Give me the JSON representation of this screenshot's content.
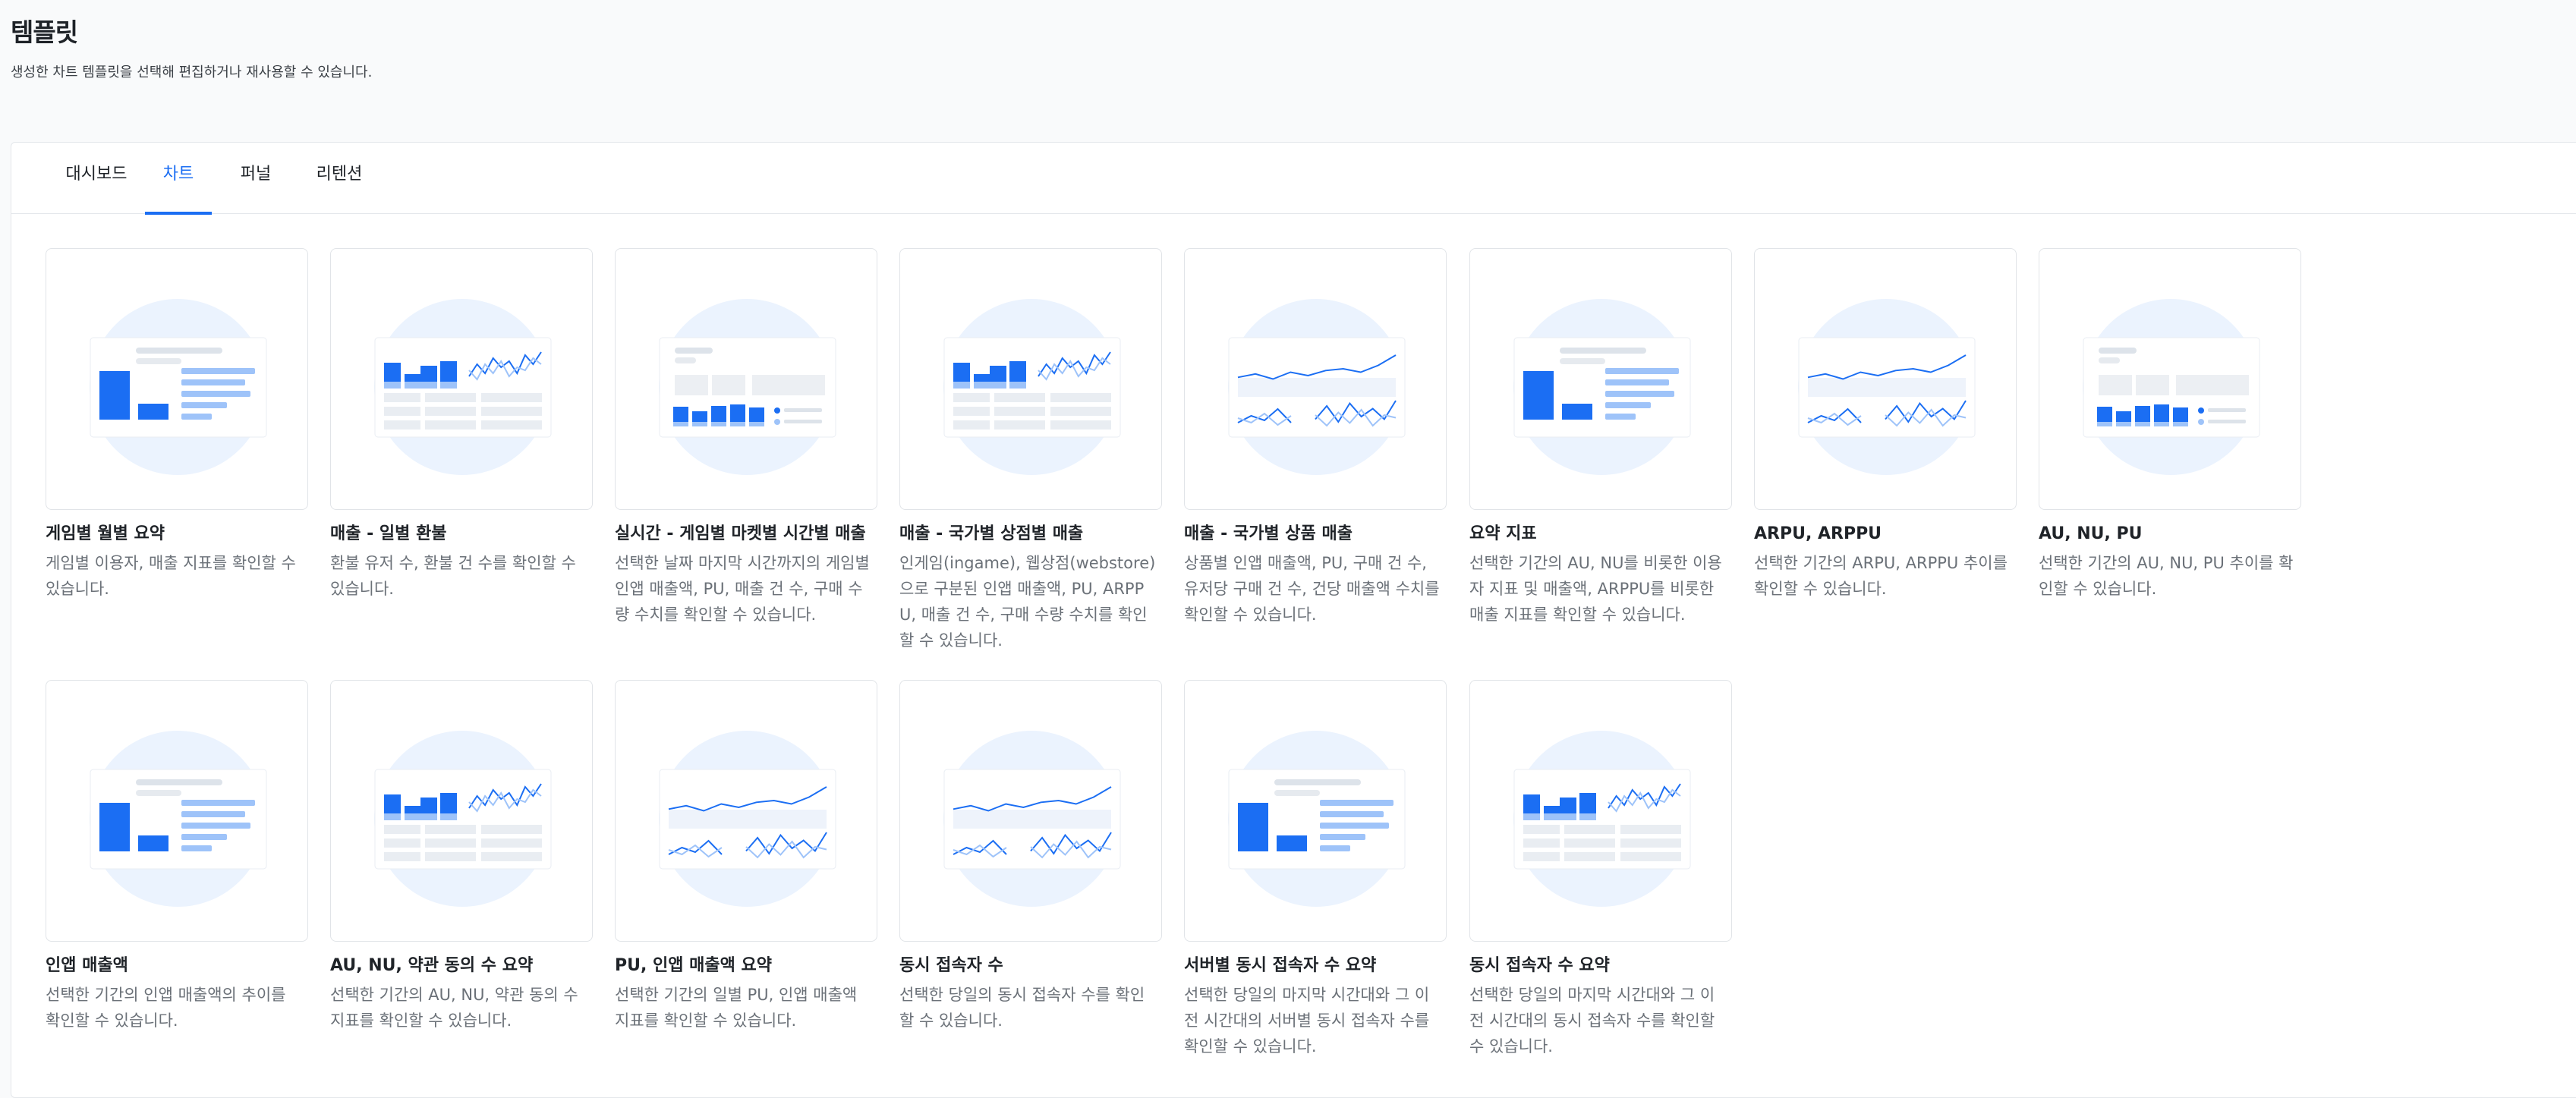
{
  "header": {
    "title": "템플릿",
    "subtitle": "생성한 차트 템플릿을 선택해 편집하거나 재사용할 수 있습니다."
  },
  "tabs": [
    {
      "label": "대시보드"
    },
    {
      "label": "차트"
    },
    {
      "label": "퍼널"
    },
    {
      "label": "리텐션"
    }
  ],
  "active_tab": "차트",
  "colors": {
    "accent": "#1b6ef3",
    "accent_light": "#9ec3f9",
    "circle": "#ebf3fe"
  },
  "templates": [
    {
      "title": "게임별 월별 요약",
      "description": "게임별 이용자, 매출 지표를 확인할 수 있습니다.",
      "thumbnail": "bar-list"
    },
    {
      "title": "매출 - 일별 환불",
      "description": "환불 유저 수, 환불 건 수를 확인할 수 있습니다.",
      "thumbnail": "bar-line-table"
    },
    {
      "title": "실시간 - 게임별 마켓별 시간별 매출",
      "description": "선택한 날짜 마지막 시간까지의 게임별 인앱 매출액, PU, 매출 건 수, 구매 수량 수치를 확인할 수 있습니다.",
      "thumbnail": "kpi-bars"
    },
    {
      "title": "매출 - 국가별 상점별 매출",
      "description": "인게임(ingame), 웹상점(webstore)으로 구분된 인앱 매출액, PU, ARPPU, 매출 건 수, 구매 수량 수치를 확인할 수 있습니다.",
      "thumbnail": "bar-line-table"
    },
    {
      "title": "매출 - 국가별 상품 매출",
      "description": "상품별 인앱 매출액, PU, 구매 건 수, 유저당 구매 건 수, 건당 매출액 수치를 확인할 수 있습니다.",
      "thumbnail": "lines"
    },
    {
      "title": "요약 지표",
      "description": "선택한 기간의 AU, NU를 비롯한 이용자 지표 및 매출액, ARPPU를 비롯한 매출 지표를 확인할 수 있습니다.",
      "thumbnail": "bar-list"
    },
    {
      "title": "ARPU, ARPPU",
      "description": "선택한 기간의 ARPU, ARPPU 추이를 확인할 수 있습니다.",
      "thumbnail": "lines"
    },
    {
      "title": "AU, NU, PU",
      "description": "선택한 기간의 AU, NU, PU 추이를 확인할 수 있습니다.",
      "thumbnail": "kpi-bars"
    },
    {
      "title": "인앱 매출액",
      "description": "선택한 기간의 인앱 매출액의 추이를 확인할 수 있습니다.",
      "thumbnail": "bar-list"
    },
    {
      "title": "AU, NU, 약관 동의 수 요약",
      "description": "선택한 기간의 AU, NU, 약관 동의 수 지표를 확인할 수 있습니다.",
      "thumbnail": "bar-line-table"
    },
    {
      "title": "PU, 인앱 매출액 요약",
      "description": "선택한 기간의 일별 PU, 인앱 매출액 지표를 확인할 수 있습니다.",
      "thumbnail": "lines"
    },
    {
      "title": "동시 접속자 수",
      "description": "선택한 당일의 동시 접속자 수를 확인할 수 있습니다.",
      "thumbnail": "lines"
    },
    {
      "title": "서버별 동시 접속자 수 요약",
      "description": "선택한 당일의 마지막 시간대와 그 이전 시간대의 서버별 동시 접속자 수를 확인할 수 있습니다.",
      "thumbnail": "bar-list"
    },
    {
      "title": "동시 접속자 수 요약",
      "description": "선택한 당일의 마지막 시간대와 그 이전 시간대의 동시 접속자 수를 확인할 수 있습니다.",
      "thumbnail": "bar-line-table"
    }
  ]
}
